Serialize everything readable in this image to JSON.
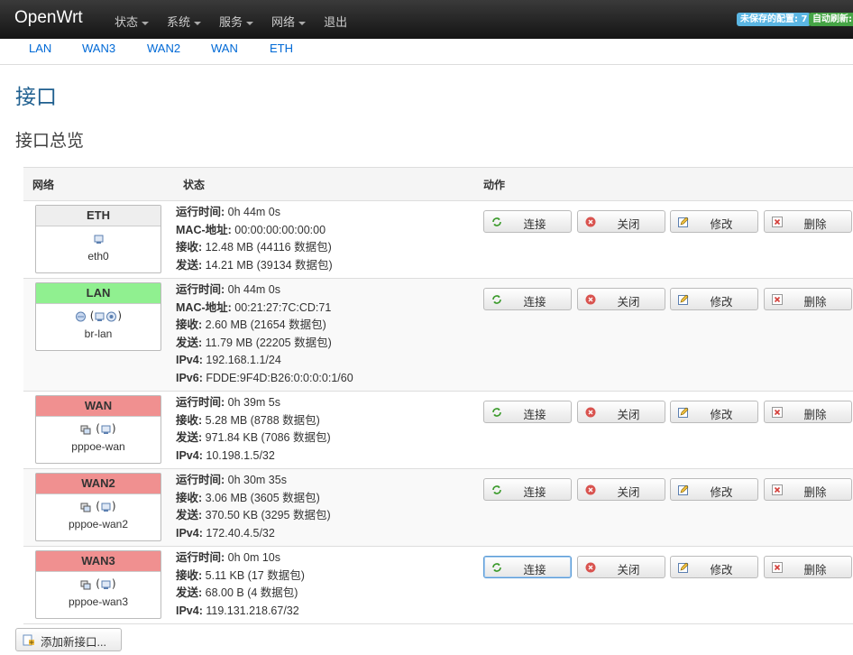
{
  "brand": "OpenWrt",
  "menu": [
    "状态",
    "系统",
    "服务",
    "网络",
    "退出"
  ],
  "badges": {
    "unsaved": "未保存的配置: 7",
    "refresh": "自动刷新: 开"
  },
  "tabs": [
    "LAN",
    "WAN3",
    "WAN2",
    "WAN",
    "ETH"
  ],
  "page_title": "接口",
  "section_title": "接口总览",
  "table_headers": {
    "network": "网络",
    "status": "状态",
    "actions": "动作"
  },
  "action_labels": {
    "connect": "连接",
    "stop": "关闭",
    "edit": "修改",
    "delete": "删除"
  },
  "interfaces": [
    {
      "name": "ETH",
      "device": "eth0",
      "header_color": "#eeeeee",
      "icons_text": "",
      "status": [
        {
          "label": "运行时间:",
          "value": " 0h 44m 0s"
        },
        {
          "label": "MAC-地址:",
          "value": " 00:00:00:00:00:00"
        },
        {
          "label": "接收:",
          "value": " 12.48 MB (44116 数据包)"
        },
        {
          "label": "发送:",
          "value": " 14.21 MB (39134 数据包)"
        }
      ]
    },
    {
      "name": "LAN",
      "device": "br-lan",
      "header_color": "#90f090",
      "icons_text": "()",
      "status": [
        {
          "label": "运行时间:",
          "value": " 0h 44m 0s"
        },
        {
          "label": "MAC-地址:",
          "value": " 00:21:27:7C:CD:71"
        },
        {
          "label": "接收:",
          "value": " 2.60 MB (21654 数据包)"
        },
        {
          "label": "发送:",
          "value": " 11.79 MB (22205 数据包)"
        },
        {
          "label": "IPv4:",
          "value": " 192.168.1.1/24"
        },
        {
          "label": "IPv6:",
          "value": " FDDE:9F4D:B26:0:0:0:0:1/60"
        }
      ]
    },
    {
      "name": "WAN",
      "device": "pppoe-wan",
      "header_color": "#f09090",
      "icons_text": "()",
      "status": [
        {
          "label": "运行时间:",
          "value": " 0h 39m 5s"
        },
        {
          "label": "接收:",
          "value": " 5.28 MB (8788 数据包)"
        },
        {
          "label": "发送:",
          "value": " 971.84 KB (7086 数据包)"
        },
        {
          "label": "IPv4:",
          "value": " 10.198.1.5/32"
        }
      ]
    },
    {
      "name": "WAN2",
      "device": "pppoe-wan2",
      "header_color": "#f09090",
      "icons_text": "()",
      "status": [
        {
          "label": "运行时间:",
          "value": " 0h 30m 35s"
        },
        {
          "label": "接收:",
          "value": " 3.06 MB (3605 数据包)"
        },
        {
          "label": "发送:",
          "value": " 370.50 KB (3295 数据包)"
        },
        {
          "label": "IPv4:",
          "value": " 172.40.4.5/32"
        }
      ]
    },
    {
      "name": "WAN3",
      "device": "pppoe-wan3",
      "header_color": "#f09090",
      "icons_text": "()",
      "status": [
        {
          "label": "运行时间:",
          "value": " 0h 0m 10s"
        },
        {
          "label": "接收:",
          "value": " 5.11 KB (17 数据包)"
        },
        {
          "label": "发送:",
          "value": " 68.00 B (4 数据包)"
        },
        {
          "label": "IPv4:",
          "value": " 119.131.218.67/32"
        }
      ]
    }
  ],
  "add_button": "添加新接口..."
}
